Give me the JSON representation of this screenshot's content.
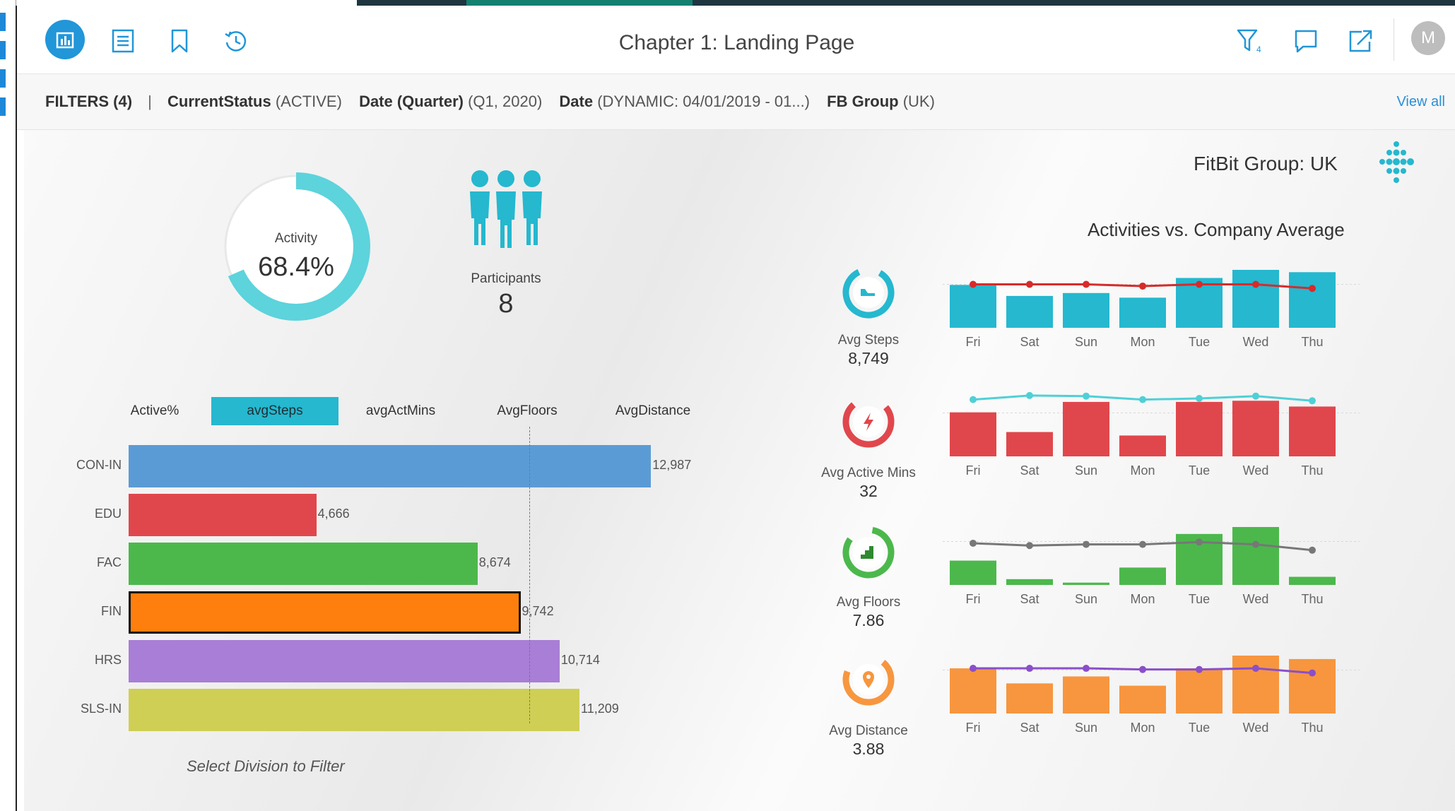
{
  "window": {
    "title": "Chapter 1: Landing Page"
  },
  "toolbar": {
    "left_icons": [
      "dashboard-icon",
      "list-icon",
      "bookmark-icon",
      "history-icon"
    ],
    "right_icons": [
      "filter-icon",
      "comment-icon",
      "share-icon"
    ],
    "filter_badge": "4",
    "avatar_initial": "M"
  },
  "filters": {
    "label": "FILTERS (4)",
    "separator": "|",
    "items": [
      {
        "name": "CurrentStatus",
        "value": "(ACTIVE)"
      },
      {
        "name": "Date (Quarter)",
        "value": "(Q1, 2020)"
      },
      {
        "name": "Date",
        "value": "(DYNAMIC: 04/01/2019 - 01...)"
      },
      {
        "name": "FB Group",
        "value": "(UK)"
      }
    ],
    "view_all": "View all"
  },
  "activity": {
    "label": "Activity",
    "value": "68.4%",
    "percent": 68.4,
    "color": "#5dd3dc"
  },
  "participants": {
    "label": "Participants",
    "value": "8",
    "color": "#25b8cf"
  },
  "metric_tabs": {
    "items": [
      "Active%",
      "avgSteps",
      "avgActMins",
      "AvgFloors",
      "AvgDistance"
    ],
    "active": "avgSteps"
  },
  "division_chart": {
    "caption": "Select Division to Filter",
    "chart_data": {
      "type": "bar",
      "orientation": "horizontal",
      "categories": [
        "CON-IN",
        "EDU",
        "FAC",
        "FIN",
        "HRS",
        "SLS-IN"
      ],
      "values": [
        12987,
        4666,
        8674,
        9742,
        10714,
        11209
      ],
      "value_labels": [
        "12,987",
        "4,666",
        "8,674",
        "9,742",
        "10,714",
        "11,209"
      ],
      "colors": [
        "#5b9bd5",
        "#e0474c",
        "#4cb84c",
        "#ff7f0e",
        "#a97ed6",
        "#cfcf55"
      ],
      "selected": "FIN",
      "reference_line": 9960,
      "xlim": [
        0,
        13000
      ]
    }
  },
  "right_panel": {
    "group_title": "FitBit Group: UK",
    "chart_title": "Activities vs. Company Average",
    "days": [
      "Fri",
      "Sat",
      "Sun",
      "Mon",
      "Tue",
      "Wed",
      "Thu"
    ],
    "kpis": [
      {
        "label": "Avg Steps",
        "value": "8,749",
        "icon": "steps-icon",
        "color": "#25b8cf"
      },
      {
        "label": "Avg Active Mins",
        "value": "32",
        "icon": "lightning-icon",
        "color": "#e0474c"
      },
      {
        "label": "Avg Floors",
        "value": "7.86",
        "icon": "stairs-icon",
        "color": "#4cb84c"
      },
      {
        "label": "Avg Distance",
        "value": "3.88",
        "icon": "location-pin-icon",
        "color": "#f7963f"
      }
    ]
  },
  "chart_data": [
    {
      "type": "bar",
      "title": "Avg Steps",
      "categories": [
        "Fri",
        "Sat",
        "Sun",
        "Mon",
        "Tue",
        "Wed",
        "Thu"
      ],
      "series": [
        {
          "values": [
            0.74,
            0.55,
            0.6,
            0.52,
            0.86,
            1.0,
            0.96
          ],
          "color": "#25b8cf",
          "kind": "bar"
        },
        {
          "values": [
            0.75,
            0.75,
            0.75,
            0.72,
            0.75,
            0.75,
            0.68
          ],
          "color": "#d62b2b",
          "kind": "line"
        }
      ]
    },
    {
      "type": "bar",
      "title": "Avg Active Mins",
      "categories": [
        "Fri",
        "Sat",
        "Sun",
        "Mon",
        "Tue",
        "Wed",
        "Thu"
      ],
      "series": [
        {
          "values": [
            0.76,
            0.42,
            0.94,
            0.36,
            0.94,
            0.96,
            0.86
          ],
          "color": "#e0474c",
          "kind": "bar"
        },
        {
          "values": [
            0.98,
            1.05,
            1.04,
            0.98,
            1.0,
            1.04,
            0.96
          ],
          "color": "#4fd0d6",
          "kind": "line"
        }
      ]
    },
    {
      "type": "bar",
      "title": "Avg Floors",
      "categories": [
        "Fri",
        "Sat",
        "Sun",
        "Mon",
        "Tue",
        "Wed",
        "Thu"
      ],
      "series": [
        {
          "values": [
            0.42,
            0.1,
            0.04,
            0.3,
            0.88,
            1.0,
            0.14
          ],
          "color": "#4cb84c",
          "kind": "bar"
        },
        {
          "values": [
            0.72,
            0.68,
            0.7,
            0.7,
            0.74,
            0.7,
            0.6
          ],
          "color": "#777777",
          "kind": "line"
        }
      ]
    },
    {
      "type": "bar",
      "title": "Avg Distance",
      "categories": [
        "Fri",
        "Sat",
        "Sun",
        "Mon",
        "Tue",
        "Wed",
        "Thu"
      ],
      "series": [
        {
          "values": [
            0.78,
            0.52,
            0.64,
            0.48,
            0.78,
            1.0,
            0.94
          ],
          "color": "#f7963f",
          "kind": "bar"
        },
        {
          "values": [
            0.78,
            0.78,
            0.78,
            0.76,
            0.76,
            0.78,
            0.7
          ],
          "color": "#8a4fc9",
          "kind": "line"
        }
      ]
    }
  ]
}
